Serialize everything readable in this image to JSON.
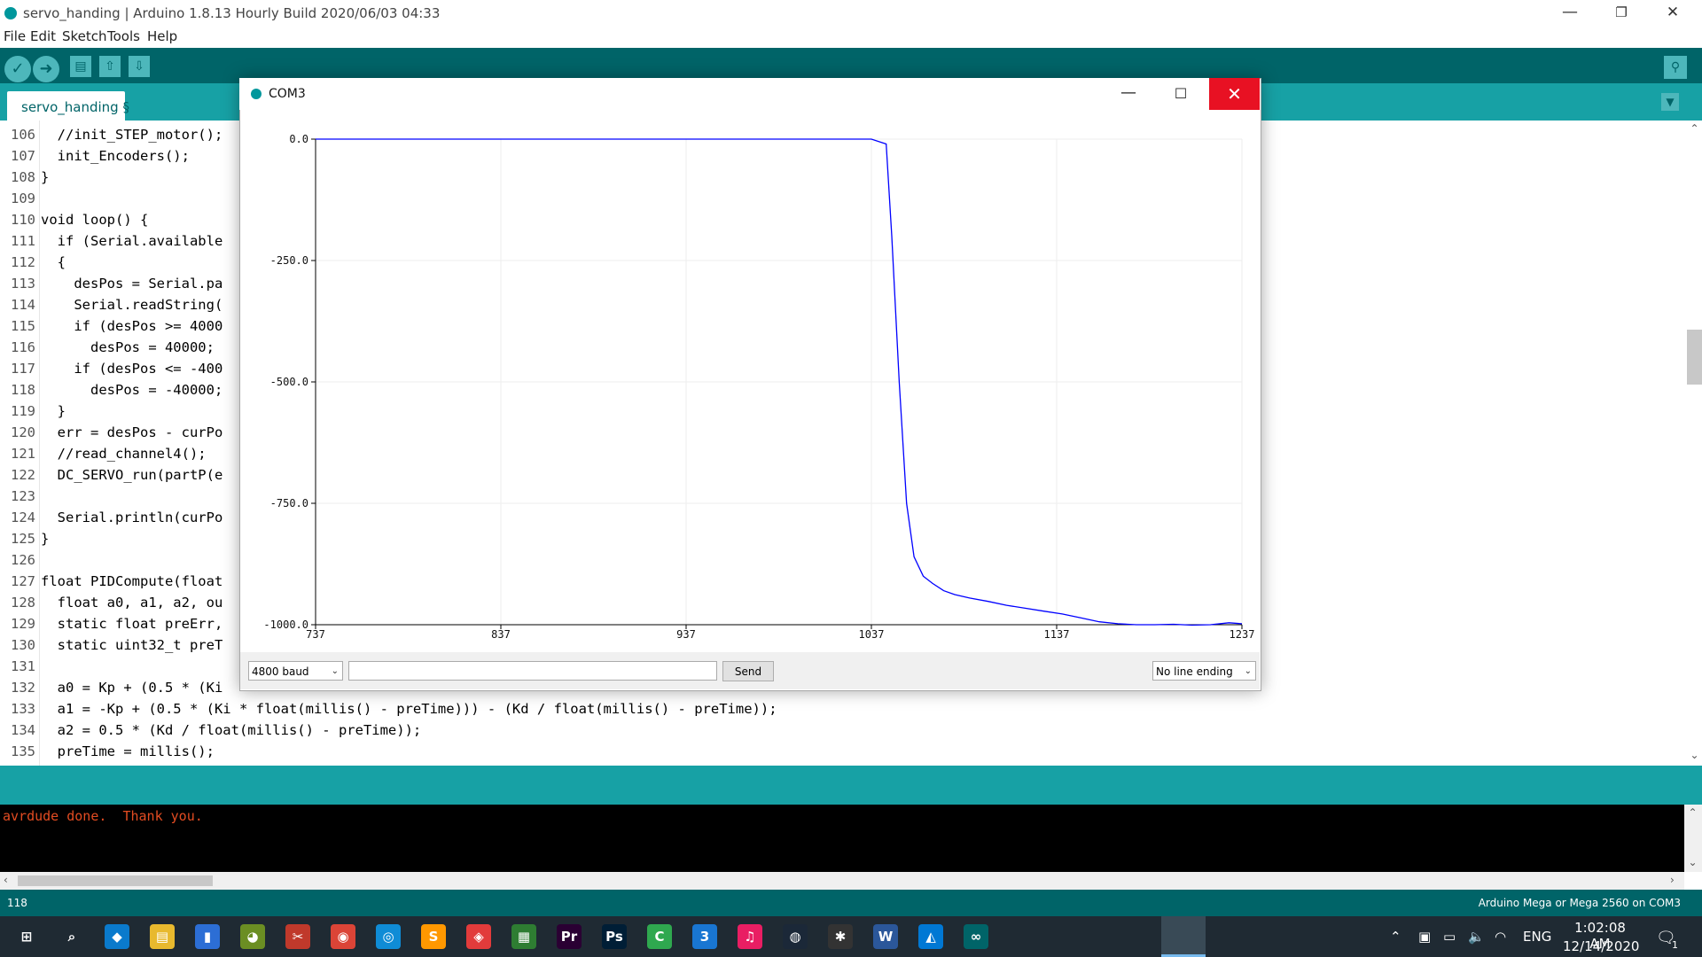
{
  "window": {
    "title": "servo_handing | Arduino 1.8.13 Hourly Build 2020/06/03 04:33",
    "controls": {
      "minimize": "—",
      "restore": "❐",
      "close": "✕"
    }
  },
  "menu": [
    "File",
    "Edit",
    "Sketch",
    "Tools",
    "Help"
  ],
  "toolbar": {
    "verify_icon": "check-icon",
    "upload_icon": "arrow-right-icon",
    "new_icon": "new-file-icon",
    "open_icon": "open-file-icon",
    "save_icon": "save-icon",
    "serial_monitor_icon": "magnifier-icon"
  },
  "tab": {
    "label": "servo_handing §"
  },
  "editor": {
    "lines": [
      {
        "n": "106",
        "code": "  //init_STEP_motor();"
      },
      {
        "n": "107",
        "code": "  init_Encoders();"
      },
      {
        "n": "108",
        "code": "}"
      },
      {
        "n": "109",
        "code": ""
      },
      {
        "n": "110",
        "code": "void loop() {"
      },
      {
        "n": "111",
        "code": "  if (Serial.available"
      },
      {
        "n": "112",
        "code": "  {"
      },
      {
        "n": "113",
        "code": "    desPos = Serial.pa"
      },
      {
        "n": "114",
        "code": "    Serial.readString("
      },
      {
        "n": "115",
        "code": "    if (desPos >= 4000"
      },
      {
        "n": "116",
        "code": "      desPos = 40000;"
      },
      {
        "n": "117",
        "code": "    if (desPos <= -400"
      },
      {
        "n": "118",
        "code": "      desPos = -40000;"
      },
      {
        "n": "119",
        "code": "  }"
      },
      {
        "n": "120",
        "code": "  err = desPos - curPo"
      },
      {
        "n": "121",
        "code": "  //read_channel4();"
      },
      {
        "n": "122",
        "code": "  DC_SERVO_run(partP(e"
      },
      {
        "n": "123",
        "code": ""
      },
      {
        "n": "124",
        "code": "  Serial.println(curPo"
      },
      {
        "n": "125",
        "code": "}"
      },
      {
        "n": "126",
        "code": ""
      },
      {
        "n": "127",
        "code": "float PIDCompute(float"
      },
      {
        "n": "128",
        "code": "  float a0, a1, a2, ou"
      },
      {
        "n": "129",
        "code": "  static float preErr,"
      },
      {
        "n": "130",
        "code": "  static uint32_t preT"
      },
      {
        "n": "131",
        "code": ""
      },
      {
        "n": "132",
        "code": "  a0 = Kp + (0.5 * (Ki"
      },
      {
        "n": "133",
        "code": "  a1 = -Kp + (0.5 * (Ki * float(millis() - preTime))) - (Kd / float(millis() - preTime));"
      },
      {
        "n": "134",
        "code": "  a2 = 0.5 * (Kd / float(millis() - preTime));"
      },
      {
        "n": "135",
        "code": "  preTime = millis();"
      }
    ]
  },
  "console": {
    "text": "avrdude done.  Thank you."
  },
  "status": {
    "line": "118",
    "board": "Arduino Mega or Mega 2560 on COM3"
  },
  "plotter": {
    "title": "COM3",
    "baud": "4800 baud",
    "send_label": "Send",
    "line_ending": "No line ending",
    "input_value": ""
  },
  "chart_data": {
    "type": "line",
    "x_ticks": [
      "737",
      "837",
      "937",
      "1037",
      "1137",
      "1237"
    ],
    "y_ticks": [
      "0.0",
      "-250.0",
      "-500.0",
      "-750.0",
      "-1000.0"
    ],
    "xlim": [
      737,
      1237
    ],
    "ylim": [
      -1000,
      0
    ],
    "grid": true,
    "series": [
      {
        "color": "#0000ff",
        "x": [
          737,
          1037,
          1045,
          1048,
          1052,
          1056,
          1060,
          1065,
          1070,
          1076,
          1082,
          1090,
          1100,
          1110,
          1120,
          1130,
          1140,
          1150,
          1160,
          1170,
          1180,
          1190,
          1200,
          1210,
          1220,
          1230,
          1237
        ],
        "y": [
          0,
          0,
          -10,
          -200,
          -500,
          -750,
          -860,
          -900,
          -915,
          -930,
          -938,
          -945,
          -952,
          -960,
          -966,
          -972,
          -978,
          -986,
          -994,
          -998,
          -1000,
          -1000,
          -999,
          -1001,
          -1000,
          -996,
          -998
        ]
      }
    ]
  },
  "taskbar": {
    "icons": [
      "start-icon",
      "search-icon",
      "vscode-icon",
      "file-explorer-icon",
      "notes-icon",
      "paint-icon",
      "snip-icon",
      "chrome-icon",
      "edge-icon",
      "sublime-icon",
      "git-icon",
      "sheet-icon",
      "premiere-icon",
      "photoshop-icon",
      "camtasia-icon",
      "app3-icon",
      "itunes-icon",
      "steam-icon",
      "tool-icon",
      "word-icon",
      "photos-icon",
      "arduino-icon"
    ],
    "language": "ENG",
    "time": "1:02:08 AM",
    "date": "12/14/2020",
    "notification_badge": "1"
  }
}
